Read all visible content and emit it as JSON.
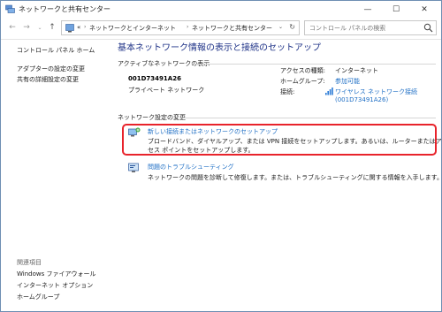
{
  "window": {
    "title": "ネットワークと共有センター",
    "controls": {
      "minimize": "—",
      "maximize": "☐",
      "close": "✕"
    }
  },
  "nav": {
    "breadcrumb": [
      "«",
      "ネットワークとインターネット",
      "ネットワークと共有センター"
    ],
    "search_placeholder": "コントロール パネルの検索"
  },
  "sidebar": {
    "items": [
      {
        "label": "コントロール パネル ホーム"
      },
      {
        "label": "アダプターの設定の変更"
      },
      {
        "label": "共有の詳細設定の変更"
      }
    ],
    "related_heading": "関連項目",
    "related": [
      {
        "label": "Windows ファイアウォール"
      },
      {
        "label": "インターネット オプション"
      },
      {
        "label": "ホームグループ"
      }
    ]
  },
  "main": {
    "title": "基本ネットワーク情報の表示と接続のセットアップ",
    "active_section": "アクティブなネットワークの表示",
    "network": {
      "name": "001D73491A26",
      "type": "プライベート ネットワーク",
      "access_label": "アクセスの種類:",
      "access_value": "インターネット",
      "homegroup_label": "ホームグループ:",
      "homegroup_value": "参加可能",
      "connection_label": "接続:",
      "connection_value_line1": "ワイヤレス ネットワーク接続",
      "connection_value_line2": "(001D73491A26)"
    },
    "change_section": "ネットワーク設定の変更",
    "tasks": [
      {
        "title": "新しい接続またはネットワークのセットアップ",
        "desc": "ブロードバンド、ダイヤルアップ、または VPN 接続をセットアップします。あるいは、ルーターまたはアクセス ポイントをセットアップします。"
      },
      {
        "title": "問題のトラブルシューティング",
        "desc": "ネットワークの問題を診断して修復します。または、トラブルシューティングに関する情報を入手します。"
      }
    ]
  }
}
